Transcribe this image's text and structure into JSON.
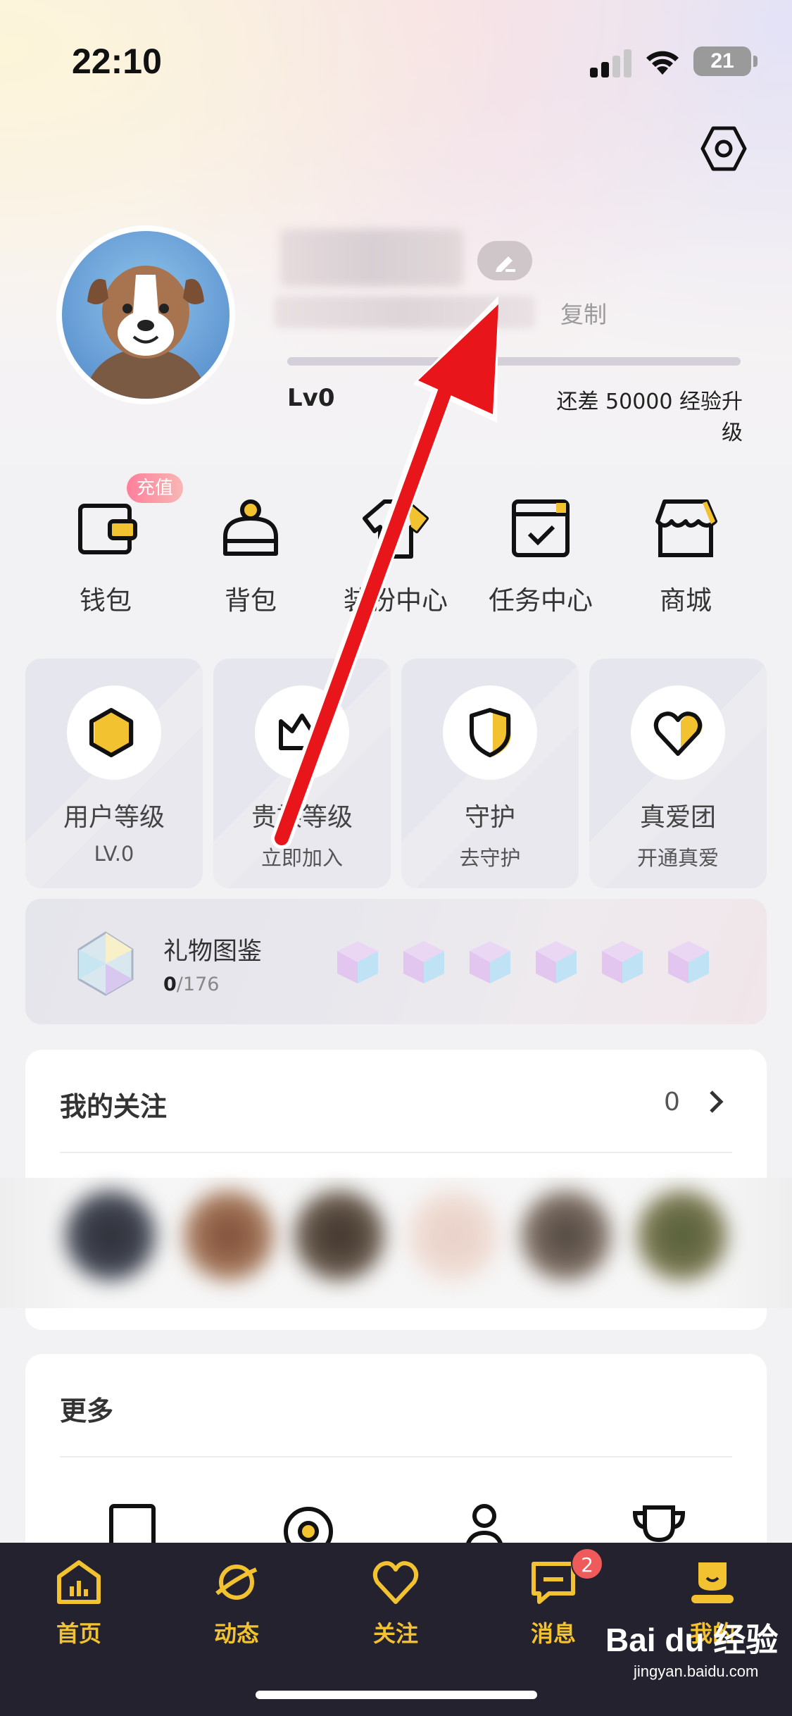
{
  "status_bar": {
    "time": "22:10",
    "battery": "21"
  },
  "profile": {
    "copy_label": "复制",
    "level": "Lv0",
    "exp_hint": "还差 50000 经验升级",
    "exp_progress": 0
  },
  "quick_menu": [
    {
      "label": "钱包",
      "icon": "wallet-icon",
      "badge": "充值"
    },
    {
      "label": "背包",
      "icon": "backpack-icon"
    },
    {
      "label": "装扮中心",
      "icon": "shirt-icon"
    },
    {
      "label": "任务中心",
      "icon": "task-icon"
    },
    {
      "label": "商城",
      "icon": "shop-icon"
    }
  ],
  "cards": [
    {
      "title": "用户等级",
      "sub": "LV.0",
      "icon": "hexagon-icon"
    },
    {
      "title": "贵族等级",
      "sub": "立即加入",
      "icon": "crown-icon"
    },
    {
      "title": "守护",
      "sub": "去守护",
      "icon": "shield-icon"
    },
    {
      "title": "真爱团",
      "sub": "开通真爱",
      "icon": "heart-icon"
    }
  ],
  "gift": {
    "title": "礼物图鉴",
    "owned": "0",
    "total": "/176"
  },
  "follow": {
    "title": "我的关注",
    "count": "0"
  },
  "more": {
    "title": "更多"
  },
  "tabs": [
    {
      "label": "首页",
      "icon": "home-chart-icon"
    },
    {
      "label": "动态",
      "icon": "planet-icon"
    },
    {
      "label": "关注",
      "icon": "heart-icon"
    },
    {
      "label": "消息",
      "icon": "message-icon",
      "badge": "2"
    },
    {
      "label": "我的",
      "icon": "profile-icon"
    }
  ],
  "watermark": {
    "brand": "Bai du 经验",
    "url": "jingyan.baidu.com"
  },
  "colors": {
    "accent": "#F2C230",
    "tab_bg": "#24222E",
    "arrow": "#E8161B",
    "badge": "#EF5B5B"
  }
}
